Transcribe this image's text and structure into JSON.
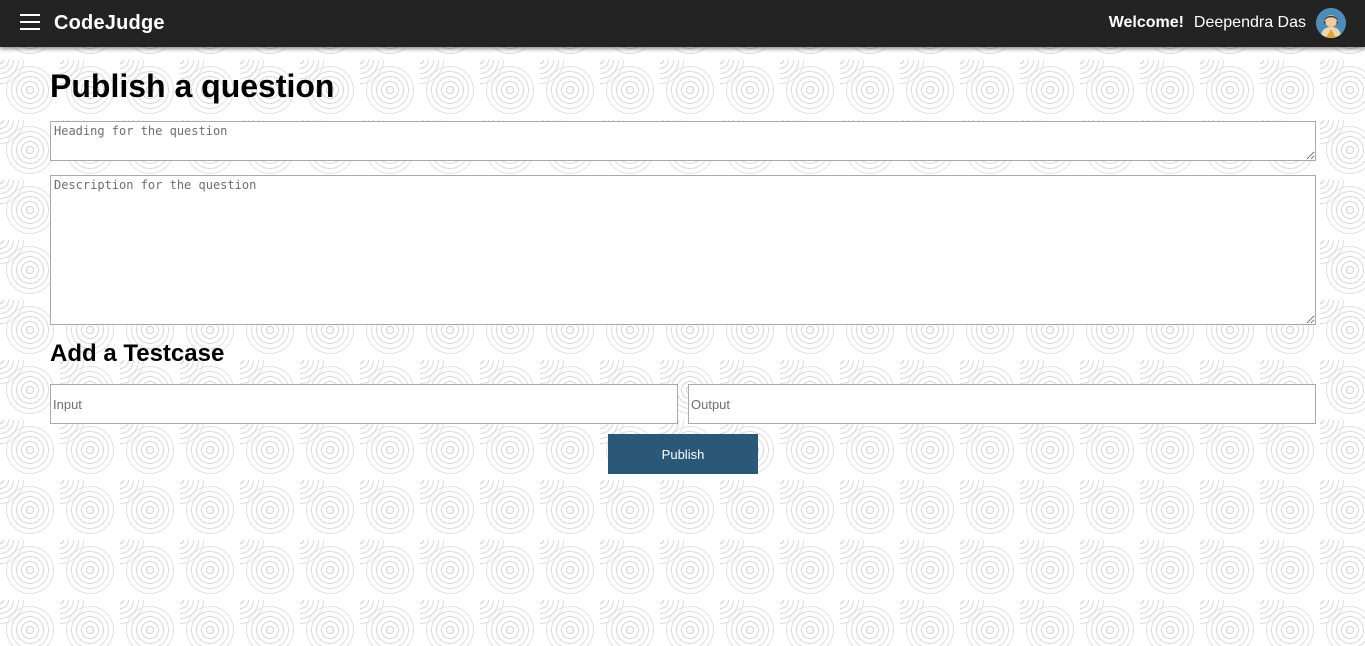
{
  "header": {
    "brand": "CodeJudge",
    "welcome": "Welcome!",
    "username": "Deependra Das",
    "menu_icon": "hamburger-menu-icon",
    "avatar_icon": "user-avatar-icon",
    "background_color": "#232323"
  },
  "main": {
    "title": "Publish a question",
    "heading_placeholder": "Heading for the question",
    "description_placeholder": "Description for the question"
  },
  "testcase": {
    "title": "Add a Testcase",
    "input_placeholder": "Input",
    "output_placeholder": "Output"
  },
  "actions": {
    "publish_label": "Publish",
    "publish_color": "#2b5876"
  }
}
